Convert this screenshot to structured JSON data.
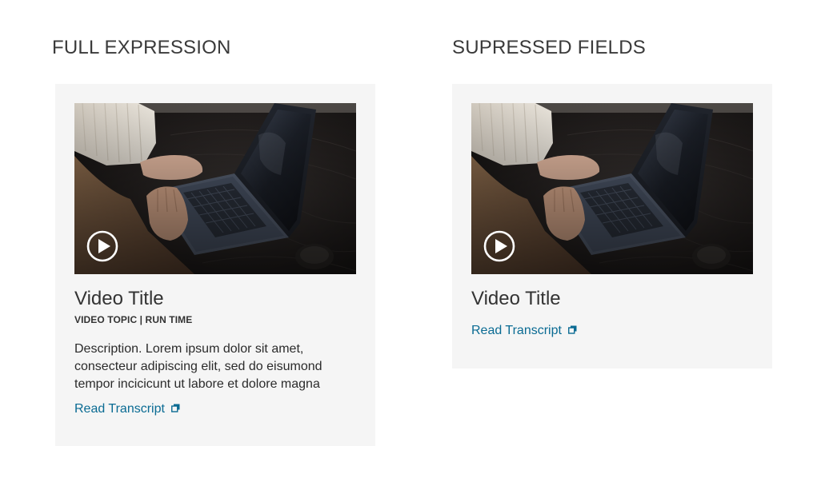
{
  "sections": {
    "full": {
      "heading": "FULL EXPRESSION",
      "video_title": "Video Title",
      "meta": "VIDEO TOPIC | RUN TIME",
      "description": "Description. Lorem ipsum dolor sit amet, consecteur adipiscing elit, sed do eisumond tempor incicicunt ut labore et dolore magna",
      "link_label": "Read Transcript"
    },
    "suppressed": {
      "heading": "SUPRESSED FIELDS",
      "video_title": "Video Title",
      "link_label": "Read Transcript"
    }
  },
  "icons": {
    "play": "play-circle-icon",
    "external": "external-link-icon"
  },
  "colors": {
    "card_background": "#f5f5f5",
    "link": "#0a6b93",
    "text": "#333333"
  }
}
